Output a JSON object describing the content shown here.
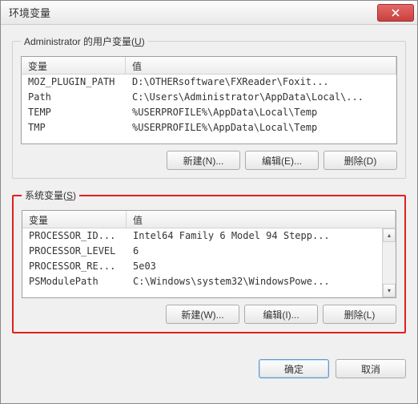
{
  "window": {
    "title": "环境变量"
  },
  "user_section": {
    "legend_prefix": "Administrator 的用户变量(",
    "legend_key": "U",
    "legend_suffix": ")",
    "headers": {
      "var": "变量",
      "val": "值"
    },
    "rows": [
      {
        "var": "MOZ_PLUGIN_PATH",
        "val": "D:\\OTHERsoftware\\FXReader\\Foxit..."
      },
      {
        "var": "Path",
        "val": "C:\\Users\\Administrator\\AppData\\Local\\..."
      },
      {
        "var": "TEMP",
        "val": "%USERPROFILE%\\AppData\\Local\\Temp"
      },
      {
        "var": "TMP",
        "val": "%USERPROFILE%\\AppData\\Local\\Temp"
      }
    ],
    "buttons": {
      "new": "新建(N)...",
      "edit": "编辑(E)...",
      "del": "删除(D)"
    }
  },
  "sys_section": {
    "legend_prefix": "系统变量(",
    "legend_key": "S",
    "legend_suffix": ")",
    "headers": {
      "var": "变量",
      "val": "值"
    },
    "rows": [
      {
        "var": "PROCESSOR_ID...",
        "val": "Intel64 Family 6 Model 94 Stepp..."
      },
      {
        "var": "PROCESSOR_LEVEL",
        "val": "6"
      },
      {
        "var": "PROCESSOR_RE...",
        "val": "5e03"
      },
      {
        "var": "PSModulePath",
        "val": "C:\\Windows\\system32\\WindowsPowe..."
      }
    ],
    "buttons": {
      "new": "新建(W)...",
      "edit": "编辑(I)...",
      "del": "删除(L)"
    }
  },
  "footer": {
    "ok": "确定",
    "cancel": "取消"
  }
}
